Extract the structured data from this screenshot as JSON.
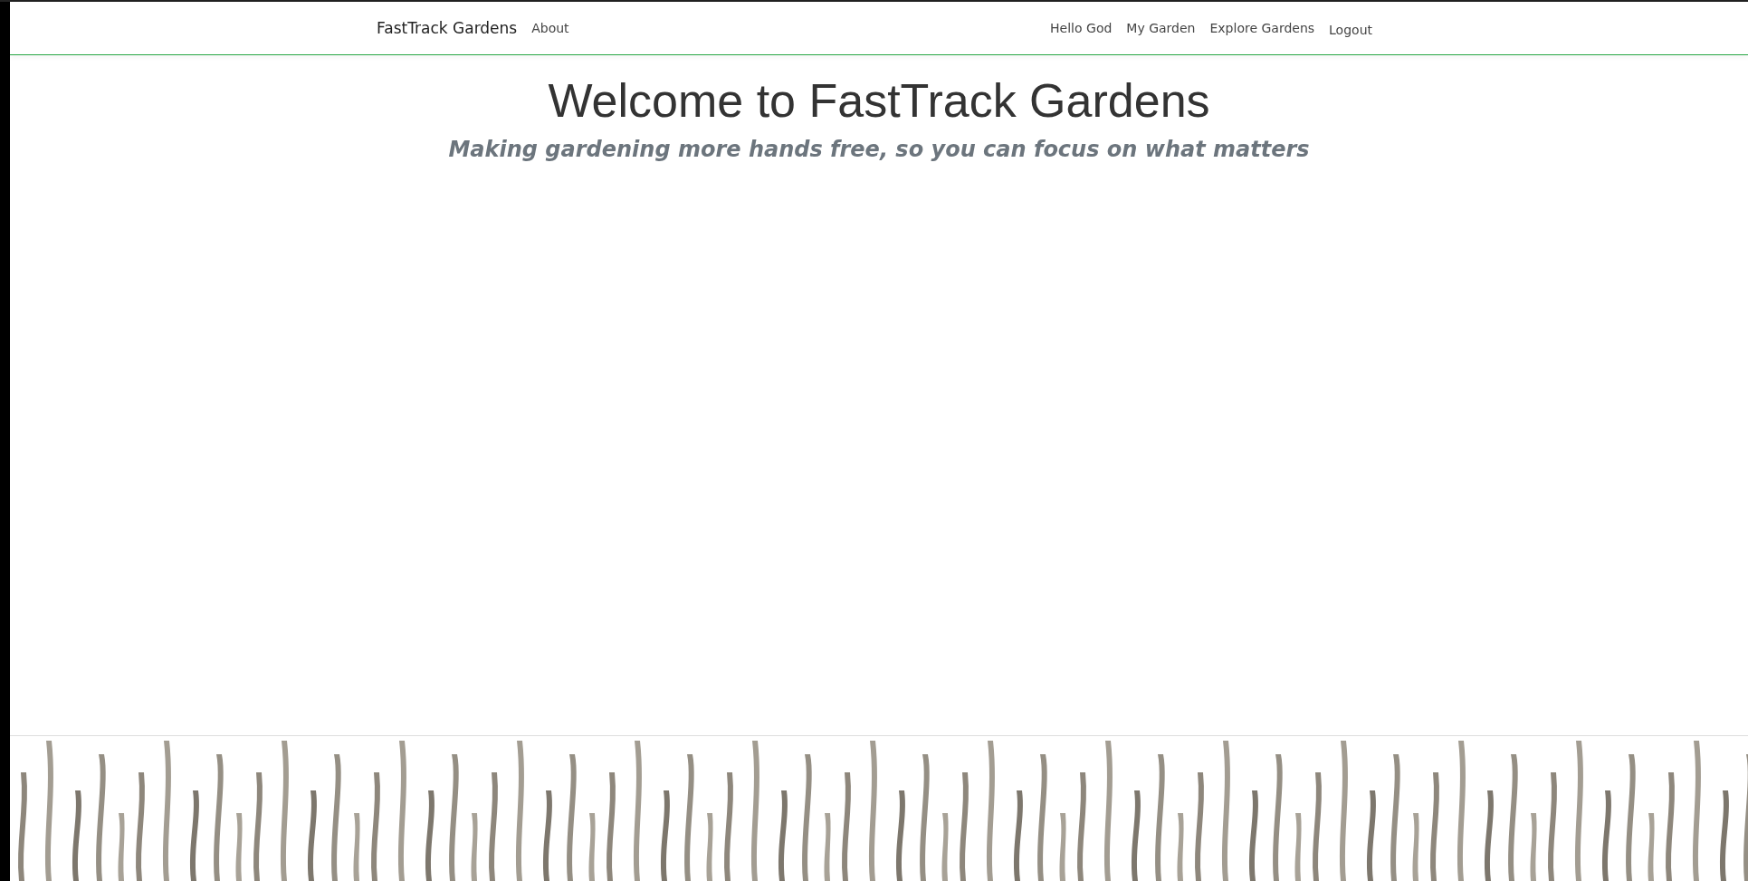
{
  "navbar": {
    "brand": "FastTrack Gardens",
    "left_links": [
      "About"
    ],
    "right_items": [
      {
        "kind": "text",
        "label": "Hello God"
      },
      {
        "kind": "link",
        "label": "My Garden"
      },
      {
        "kind": "link",
        "label": "Explore Gardens"
      },
      {
        "kind": "button",
        "label": "Logout"
      }
    ]
  },
  "hero": {
    "title": "Welcome to FastTrack Gardens",
    "subtitle": "Making gardening more hands free, so you can focus on what matters"
  }
}
